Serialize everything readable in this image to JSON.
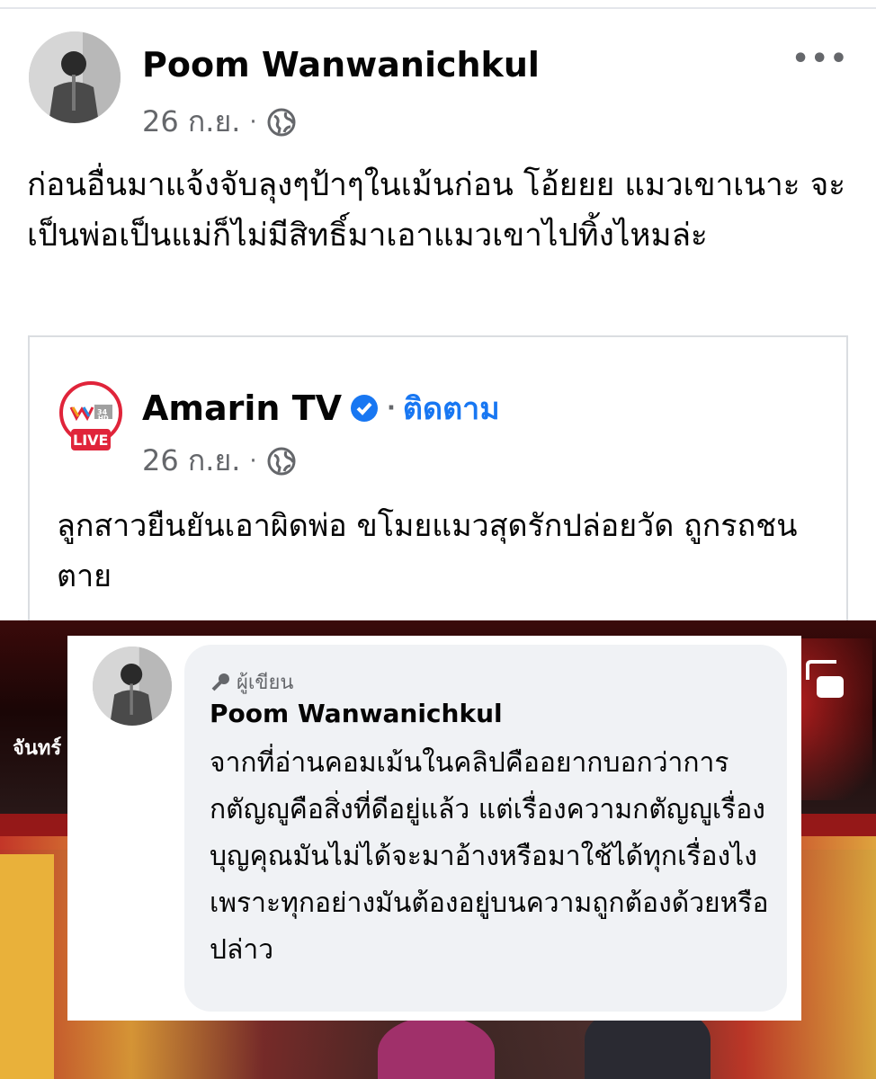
{
  "post": {
    "author_name": "Poom Wanwanichkul",
    "date": "26 ก.ย.",
    "separator": "·",
    "audience_icon": "globe-icon",
    "more_icon": "more-options-icon",
    "more_label": "•••",
    "text": "ก่อนอื่นมาแจ้งจับลุงๆป้าๆในเม้นก่อน โอ้ยยย แมวเขาเนาะ จะเป็นพ่อเป็นแม่ก็ไม่มีสิทธิ์มาเอาแมวเขาไปทิ้งไหมล่ะ"
  },
  "shared": {
    "page_name": "Amarin TV",
    "verified_icon": "verified-badge-icon",
    "separator": "·",
    "follow_label": "ติดตาม",
    "date": "26 ก.ย.",
    "audience_icon": "globe-icon",
    "logo_badge": "LIVE",
    "logo_channel": "34",
    "logo_hd": "HD",
    "text": "ลูกสาวยืนยันเอาผิดพ่อ ขโมยแมวสุดรักปล่อยวัด ถูกรถชนตาย"
  },
  "video": {
    "label": "จันทร์",
    "pip_icon": "picture-in-picture-icon"
  },
  "comment": {
    "badge_icon": "microphone-icon",
    "badge_label": "ผู้เขียน",
    "author_name": "Poom Wanwanichkul",
    "text": "จากที่อ่านคอมเม้นในคลิปคืออยากบอกว่าการกตัญญูคือสิ่งที่ดีอยู่แล้ว แต่เรื่องความกตัญญูเรื่องบุญคุณมันไม่ได้จะมาอ้างหรือมาใช้ได้ทุกเรื่องไง เพราะทุกอย่างมันต้องอยู่บนความถูกต้องด้วยหรือปล่าว"
  },
  "colors": {
    "link_blue": "#1877f2",
    "meta_gray": "#65676b",
    "bubble_bg": "#f0f2f5",
    "live_red": "#e0243a"
  }
}
